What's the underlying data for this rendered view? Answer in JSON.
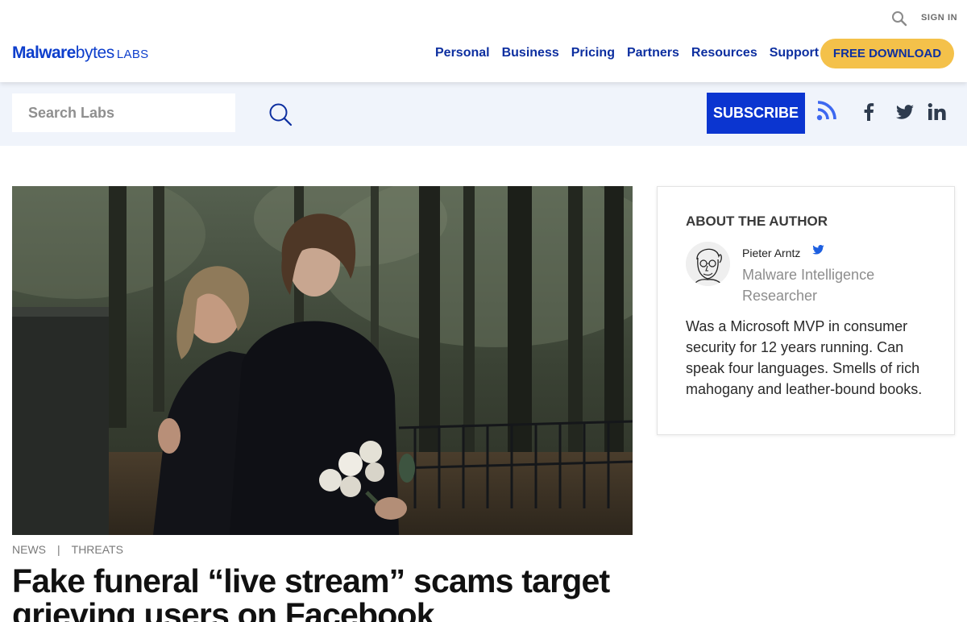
{
  "header": {
    "sign_in": "SIGN IN",
    "logo": {
      "part1": "Malware",
      "part2": "bytes",
      "part3": "LABS"
    },
    "nav": [
      "Personal",
      "Business",
      "Pricing",
      "Partners",
      "Resources",
      "Support"
    ],
    "cta": "FREE DOWNLOAD"
  },
  "subbar": {
    "search_placeholder": "Search Labs",
    "subscribe": "SUBSCRIBE",
    "social_icons": [
      "rss-icon",
      "facebook-icon",
      "twitter-icon",
      "linkedin-icon"
    ]
  },
  "post": {
    "categories": [
      "NEWS",
      "THREATS"
    ],
    "separator": "|",
    "title": "Fake funeral “live stream” scams target grieving users on Facebook"
  },
  "author": {
    "heading": "ABOUT THE AUTHOR",
    "name": "Pieter Arntz",
    "role": "Malware Intelligence Researcher",
    "bio": "Was a Microsoft MVP in consumer security for 12 years running. Can speak four languages. Smells of rich mahogany and leather-bound books."
  },
  "colors": {
    "brand_blue": "#0d3ecc",
    "nav_blue": "#0d2fa0",
    "cta_yellow": "#f4c14a",
    "subscribe_blue": "#0b35d0",
    "subbar_bg": "#f0f4fb"
  }
}
